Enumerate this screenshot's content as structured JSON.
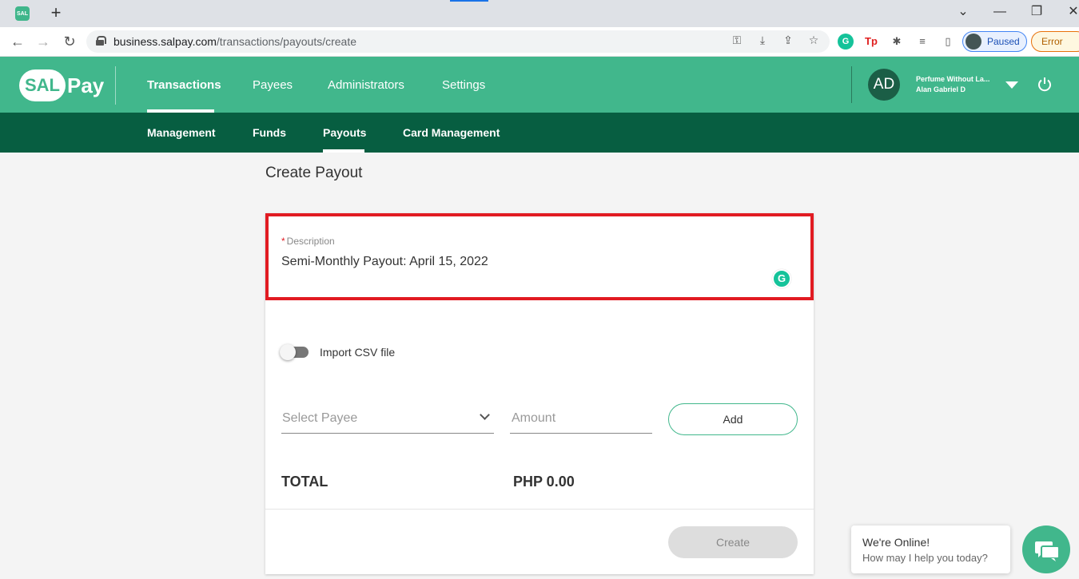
{
  "browser": {
    "favicon_text": "SAL",
    "url_domain": "business.salpay.com",
    "url_path": "/transactions/payouts/create",
    "profile_label": "Paused",
    "error_label": "Error"
  },
  "header": {
    "logo_cloud": "SAL",
    "logo_text": "Pay",
    "nav": [
      "Transactions",
      "Payees",
      "Administrators",
      "Settings"
    ],
    "active_nav": "Transactions",
    "account": {
      "initials": "AD",
      "business_name": "Perfume Without La...",
      "user_name": "Alan Gabriel D"
    }
  },
  "subnav": {
    "items": [
      "Management",
      "Funds",
      "Payouts",
      "Card Management"
    ],
    "active": "Payouts"
  },
  "page": {
    "title": "Create Payout",
    "description": {
      "required_marker": "*",
      "label": "Description",
      "value": "Semi-Monthly Payout: April 15, 2022"
    },
    "import_csv": {
      "label": "Import CSV file",
      "enabled": false
    },
    "payee_select": {
      "placeholder": "Select Payee"
    },
    "amount": {
      "placeholder": "Amount"
    },
    "add_label": "Add",
    "total_label": "TOTAL",
    "total_value": "PHP 0.00",
    "create_label": "Create"
  },
  "chat": {
    "title": "We're Online!",
    "subtitle": "How may I help you today?"
  },
  "colors": {
    "brand": "#41b78c",
    "brand_dark": "#075e41",
    "highlight": "#e11b22"
  },
  "icons": [
    "back-icon",
    "forward-icon",
    "reload-icon",
    "lock-icon",
    "key-icon",
    "download-icon",
    "share-icon",
    "star-icon",
    "grammarly-icon",
    "extensions-icon",
    "media-icon",
    "sidepanel-icon",
    "caret-down-icon",
    "power-icon",
    "chevron-down-icon",
    "chat-icon"
  ]
}
